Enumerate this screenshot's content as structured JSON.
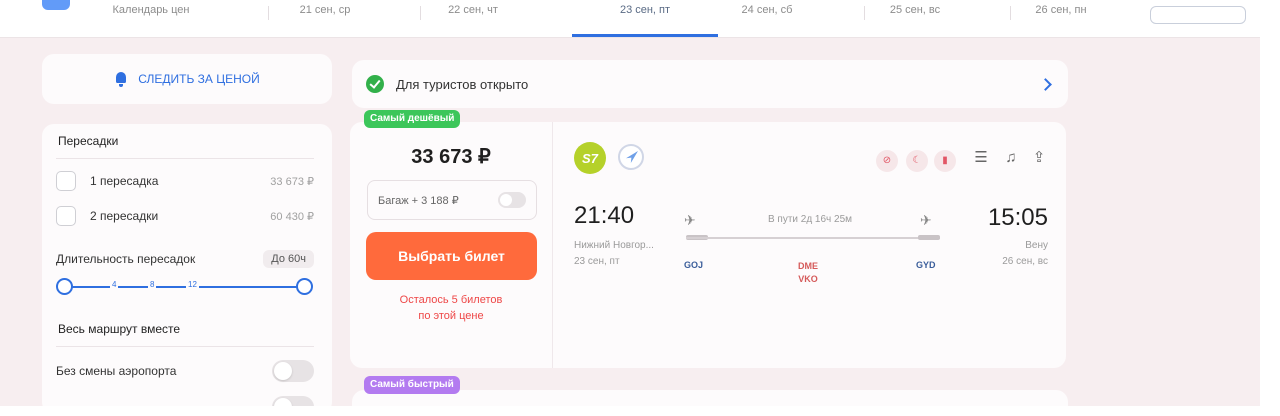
{
  "date_strip": {
    "tabs": [
      {
        "label": "Календарь цен"
      },
      {
        "label": "21 сен, ср"
      },
      {
        "label": "22 сен, чт"
      },
      {
        "label": "23 сен, пт"
      },
      {
        "label": "24 сен, сб"
      },
      {
        "label": "25 сен, вс"
      },
      {
        "label": "26 сен, пн"
      }
    ],
    "active_index": 3
  },
  "alert": {
    "label": "СЛЕДИТЬ ЗА ЦЕНОЙ"
  },
  "filters": {
    "transfers_title": "Пересадки",
    "options": [
      {
        "label": "1 пересадка",
        "price": "33 673 ₽"
      },
      {
        "label": "2 пересадки",
        "price": "60 430 ₽"
      }
    ],
    "duration_label": "Длительность пересадок",
    "duration_value": "До 60ч",
    "slider_ticks": [
      "4",
      "8",
      "12"
    ],
    "airport_title": "Весь маршрут вместе",
    "no_airport_change": "Без смены аэропорта"
  },
  "banner": {
    "text": "Для туристов открыто"
  },
  "ticket": {
    "badge": "Самый дешёвый",
    "price": "33 673 ₽",
    "baggage_label": "Багаж + 3 188 ₽",
    "buy_label": "Выбрать билет",
    "seats_left_line1": "Осталось 5 билетов",
    "seats_left_line2": "по этой цене",
    "airline_code": "S7",
    "departure": {
      "time": "21:40",
      "city": "Нижний Новгор...",
      "date": "23 сен, пт",
      "iata": "GOJ"
    },
    "arrival": {
      "time": "15:05",
      "city": "Вену",
      "date": "26 сен, вс",
      "iata": "GYD"
    },
    "duration": "В пути 2д 16ч 25м",
    "stops": [
      "DME",
      "VKO"
    ],
    "colors": {
      "buy": "#ff6a3c",
      "badge": "#3cc65a",
      "accent": "#2f6fe0"
    }
  },
  "next_badge": "Самый быстрый",
  "icons": {
    "filters": "filter-list-icon",
    "subscribe": "bell-icon",
    "share": "share-icon"
  }
}
